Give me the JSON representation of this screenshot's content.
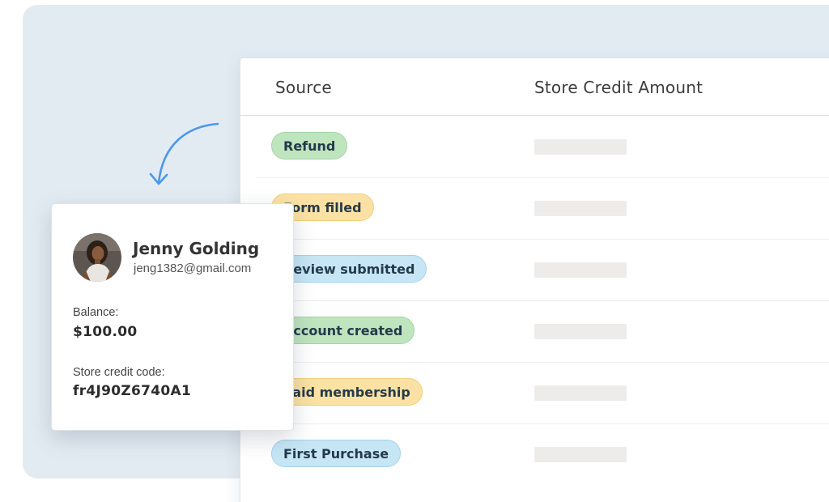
{
  "table": {
    "columns": {
      "source": "Source",
      "amount": "Store Credit Amount"
    },
    "rows": [
      {
        "source": "Refund",
        "tag_color": "green"
      },
      {
        "source": "Form filled",
        "tag_color": "yellow"
      },
      {
        "source": "Review submitted",
        "tag_color": "blue"
      },
      {
        "source": "Account created",
        "tag_color": "green"
      },
      {
        "source": "Paid membership",
        "tag_color": "yellow"
      },
      {
        "source": "First Purchase",
        "tag_color": "blue"
      }
    ]
  },
  "customer": {
    "name": "Jenny Golding",
    "email": "jeng1382@gmail.com",
    "balance_label": "Balance:",
    "balance_value": "$100.00",
    "code_label": "Store credit code:",
    "code_value": "fr4J90Z6740A1"
  },
  "colors": {
    "backdrop": "#e3ebf2",
    "arrow": "#4d98e8",
    "tag_green": "#bfe5bf",
    "tag_yellow": "#fbe2a4",
    "tag_blue": "#c6e6f5",
    "placeholder": "#eeeceb"
  },
  "icons": {
    "arrow": "curved-arrow-icon",
    "avatar": "user-photo"
  }
}
